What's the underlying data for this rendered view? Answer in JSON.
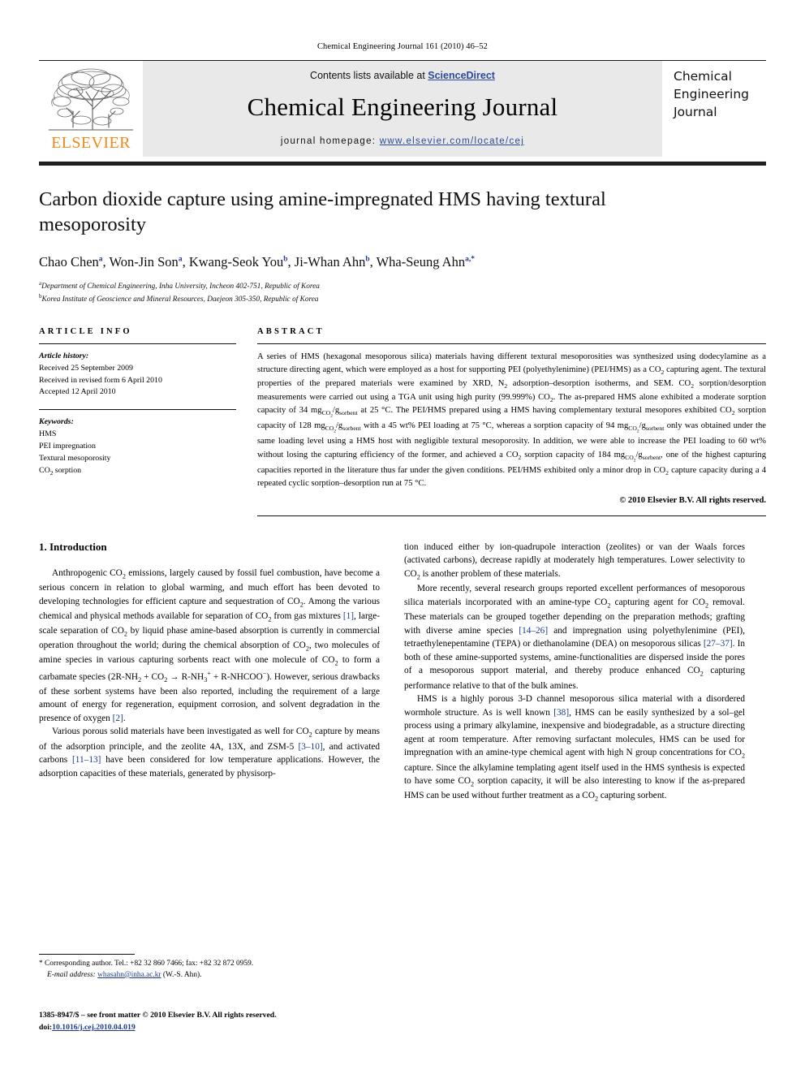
{
  "running_head": "Chemical Engineering Journal 161 (2010) 46–52",
  "masthead": {
    "logo_word": "ELSEVIER",
    "contents_prefix": "Contents lists available at ",
    "contents_link": "ScienceDirect",
    "journal_name": "Chemical Engineering Journal",
    "homepage_prefix": "journal homepage: ",
    "homepage_url": "www.elsevier.com/locate/cej",
    "cover_line1": "Chemical",
    "cover_line2": "Engineering",
    "cover_line3": "Journal",
    "link_color": "#2b4a9b",
    "logo_color": "#f08a1b",
    "panel_bg": "#e9e9e9"
  },
  "title": "Carbon dioxide capture using amine-impregnated HMS having textural mesoporosity",
  "authors": [
    {
      "name": "Chao Chen",
      "sup": "a",
      "sep": ", "
    },
    {
      "name": "Won-Jin Son",
      "sup": "a",
      "sep": ", "
    },
    {
      "name": "Kwang-Seok You",
      "sup": "b",
      "sep": ", "
    },
    {
      "name": "Ji-Whan Ahn",
      "sup": "b",
      "sep": ", "
    },
    {
      "name": "Wha-Seung Ahn",
      "sup": "a,*",
      "sep": ""
    }
  ],
  "affiliations": [
    {
      "mark": "a",
      "text": "Department of Chemical Engineering, Inha University, Incheon 402-751, Republic of Korea"
    },
    {
      "mark": "b",
      "text": "Korea Institute of Geoscience and Mineral Resources, Daejeon 305-350, Republic of Korea"
    }
  ],
  "article_info": {
    "heading": "ARTICLE INFO",
    "history_label": "Article history:",
    "history": [
      "Received 25 September 2009",
      "Received in revised form 6 April 2010",
      "Accepted 12 April 2010"
    ],
    "keywords_label": "Keywords:",
    "keywords": [
      "HMS",
      "PEI impregnation",
      "Textural mesoporosity",
      "CO2 sorption"
    ]
  },
  "abstract": {
    "heading": "ABSTRACT",
    "text": "A series of HMS (hexagonal mesoporous silica) materials having different textural mesoporosities was synthesized using dodecylamine as a structure directing agent, which were employed as a host for supporting PEI (polyethylenimine) (PEI/HMS) as a CO2 capturing agent. The textural properties of the prepared materials were examined by XRD, N2 adsorption–desorption isotherms, and SEM. CO2 sorption/desorption measurements were carried out using a TGA unit using high purity (99.999%) CO2. The as-prepared HMS alone exhibited a moderate sorption capacity of 34 mgCO2/gsorbent at 25 °C. The PEI/HMS prepared using a HMS having complementary textural mesopores exhibited CO2 sorption capacity of 128 mgCO2/gsorbent with a 45 wt% PEI loading at 75 °C, whereas a sorption capacity of 94 mgCO2/gsorbent only was obtained under the same loading level using a HMS host with negligible textural mesoporosity. In addition, we were able to increase the PEI loading to 60 wt% without losing the capturing efficiency of the former, and achieved a CO2 sorption capacity of 184 mgCO2/gsorbent, one of the highest capturing capacities reported in the literature thus far under the given conditions. PEI/HMS exhibited only a minor drop in CO2 capture capacity during a 4 repeated cyclic sorption–desorption run at 75 °C.",
    "copyright": "© 2010 Elsevier B.V. All rights reserved."
  },
  "section": {
    "number_title": "1. Introduction"
  },
  "body": {
    "left_paragraphs": [
      "Anthropogenic CO2 emissions, largely caused by fossil fuel combustion, have become a serious concern in relation to global warming, and much effort has been devoted to developing technologies for efficient capture and sequestration of CO2. Among the various chemical and physical methods available for separation of CO2 from gas mixtures [1], large-scale separation of CO2 by liquid phase amine-based absorption is currently in commercial operation throughout the world; during the chemical absorption of CO2, two molecules of amine species in various capturing sorbents react with one molecule of CO2 to form a carbamate species (2R-NH2 + CO2 → R-NH3+ + R-NHCOO−). However, serious drawbacks of these sorbent systems have been also reported, including the requirement of a large amount of energy for regeneration, equipment corrosion, and solvent degradation in the presence of oxygen [2].",
      "Various porous solid materials have been investigated as well for CO2 capture by means of the adsorption principle, and the zeolite 4A, 13X, and ZSM-5 [3–10], and activated carbons [11–13] have been considered for low temperature applications. However, the adsorption capacities of these materials, generated by physisorp-"
    ],
    "right_paragraphs": [
      "tion induced either by ion-quadrupole interaction (zeolites) or van der Waals forces (activated carbons), decrease rapidly at moderately high temperatures. Lower selectivity to CO2 is another problem of these materials.",
      "More recently, several research groups reported excellent performances of mesoporous silica materials incorporated with an amine-type CO2 capturing agent for CO2 removal. These materials can be grouped together depending on the preparation methods; grafting with diverse amine species [14–26] and impregnation using polyethylenimine (PEI), tetraethylenepentamine (TEPA) or diethanolamine (DEA) on mesoporous silicas [27–37]. In both of these amine-supported systems, amine-functionalities are dispersed inside the pores of a mesoporous support material, and thereby produce enhanced CO2 capturing performance relative to that of the bulk amines.",
      "HMS is a highly porous 3-D channel mesoporous silica material with a disordered wormhole structure. As is well known [38], HMS can be easily synthesized by a sol–gel process using a primary alkylamine, inexpensive and biodegradable, as a structure directing agent at room temperature. After removing surfactant molecules, HMS can be used for impregnation with an amine-type chemical agent with high N group concentrations for CO2 capture. Since the alkylamine templating agent itself used in the HMS synthesis is expected to have some CO2 sorption capacity, it will be also interesting to know if the as-prepared HMS can be used without further treatment as a CO2 capturing sorbent."
    ]
  },
  "footnote": {
    "star": "*",
    "corresponding": " Corresponding author. Tel.: +82 32 860 7466; fax: +82 32 872 0959.",
    "email_label": "E-mail address:",
    "email": "whasahn@inha.ac.kr",
    "email_suffix": " (W.-S. Ahn)."
  },
  "imprint": {
    "line1": "1385-8947/$ – see front matter © 2010 Elsevier B.V. All rights reserved.",
    "doi_prefix": "doi:",
    "doi": "10.1016/j.cej.2010.04.019"
  }
}
